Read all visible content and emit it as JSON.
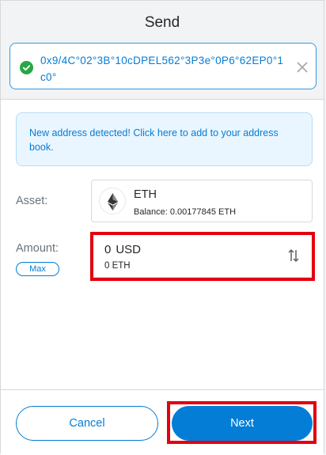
{
  "header": {
    "title": "Send",
    "recipient_address": "0x9/4C°02°3B°10cDPEL562°3P3e°0P6°62EP0°1c0°"
  },
  "notice": {
    "text": "New address detected! Click here to add to your address book."
  },
  "asset": {
    "label": "Asset:",
    "name": "ETH",
    "balance": "Balance: 0.00177845 ETH",
    "icon": "ethereum-icon"
  },
  "amount": {
    "label": "Amount:",
    "max_label": "Max",
    "value": "0",
    "unit": "USD",
    "secondary": "0 ETH"
  },
  "footer": {
    "cancel_label": "Cancel",
    "next_label": "Next"
  },
  "colors": {
    "accent": "#037dd6",
    "success": "#28a745",
    "highlight": "#e3000f"
  }
}
